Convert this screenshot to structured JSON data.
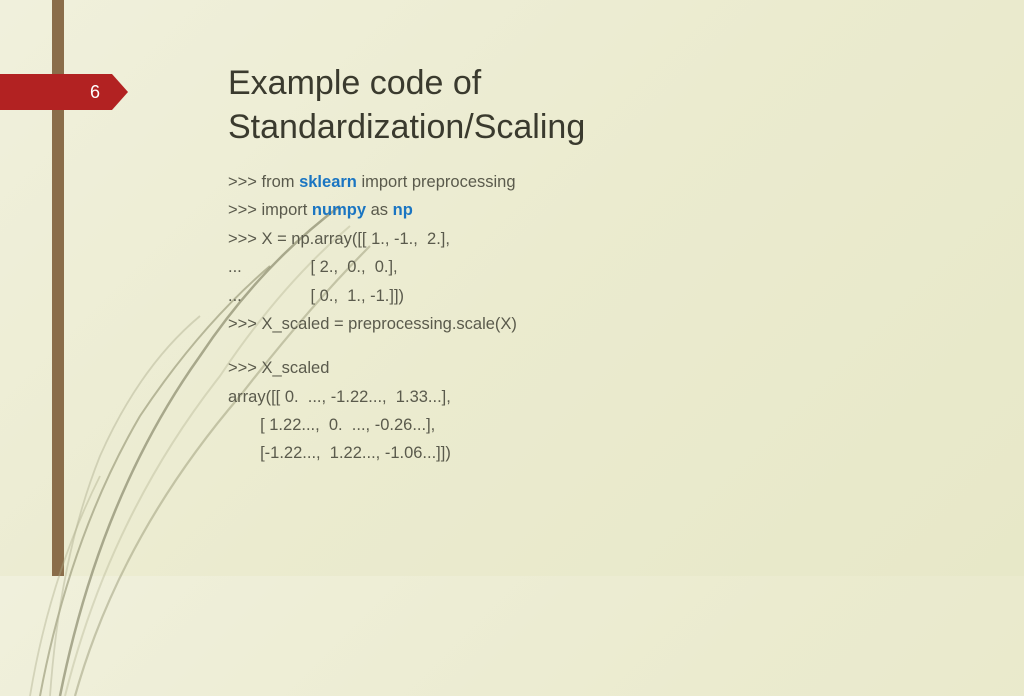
{
  "page_number": "6",
  "title_line1": "Example code of",
  "title_line2": "Standardization/Scaling",
  "code": {
    "l1_pre": ">>> from ",
    "l1_kw": "sklearn",
    "l1_post": " import preprocessing",
    "l2_pre": ">>> import ",
    "l2_kw1": "numpy",
    "l2_mid": " as ",
    "l2_kw2": "np",
    "l3": ">>> X = np.array([[ 1., -1.,  2.],",
    "l4": "...               [ 2.,  0.,  0.],",
    "l5": "...               [ 0.,  1., -1.]])",
    "l6": ">>> X_scaled = preprocessing.scale(X)",
    "l7": ">>> X_scaled",
    "l8": "array([[ 0.  ..., -1.22...,  1.33...],",
    "l9": "       [ 1.22...,  0.  ..., -0.26...],",
    "l10": "       [-1.22...,  1.22..., -1.06...]])"
  }
}
